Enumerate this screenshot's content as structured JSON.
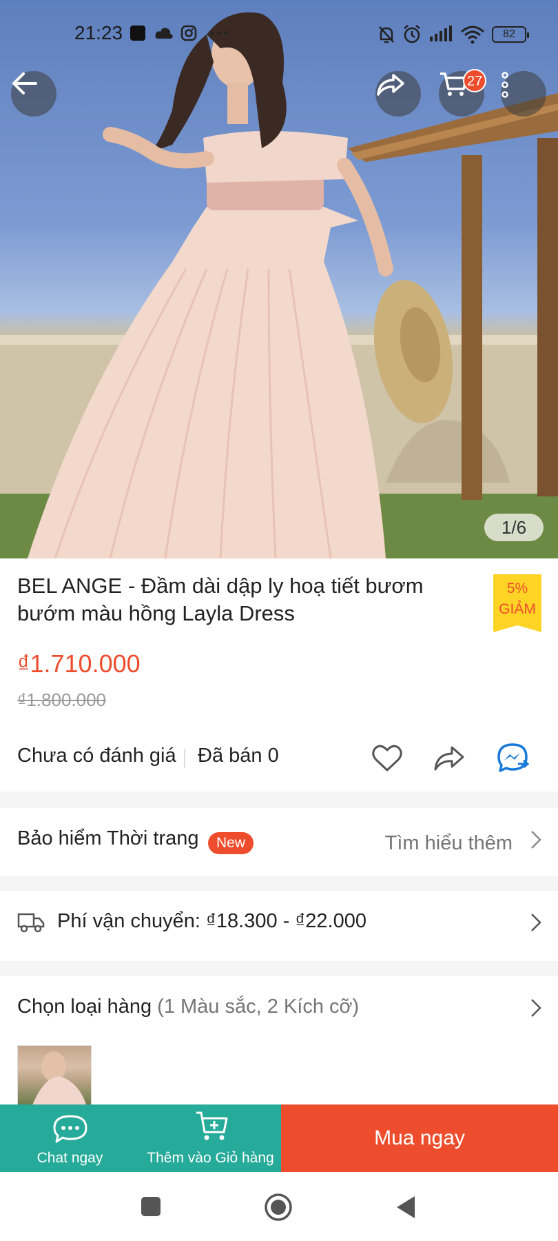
{
  "status_bar": {
    "time": "21:23",
    "battery": "82",
    "icons": [
      "notification-square-icon",
      "cloud-icon",
      "instagram-icon",
      "more-dots-icon",
      "mute-bell-icon",
      "alarm-icon",
      "signal-icon",
      "wifi-icon",
      "battery-icon"
    ]
  },
  "header": {
    "back_icon": "arrow-left-icon",
    "share_icon": "share-icon",
    "cart_icon": "cart-icon",
    "cart_count": "27",
    "menu_icon": "more-vertical-icon"
  },
  "gallery": {
    "counter": "1/6"
  },
  "product": {
    "title": "BEL ANGE - Đầm dài dập ly hoạ tiết bươm bướm màu hồng Layla Dress",
    "discount_percent": "5%",
    "discount_label": "GIẢM",
    "price": "₫1.710.000",
    "original_price": "₫1.800.000",
    "rating_text": "Chưa có đánh giá",
    "sold_text": "Đã bán 0"
  },
  "insurance": {
    "label": "Bảo hiểm Thời trang",
    "badge": "New",
    "link": "Tìm hiểu thêm"
  },
  "shipping": {
    "label": "Phí vận chuyển: ₫18.300 - ₫22.000"
  },
  "variants": {
    "label": "Chọn loại hàng",
    "detail": "(1 Màu sắc, 2 Kích cỡ)"
  },
  "bottom_bar": {
    "chat_label": "Chat ngay",
    "add_cart_label": "Thêm vào Giỏ hàng",
    "buy_label": "Mua ngay"
  },
  "colors": {
    "accent": "#ee4d2d",
    "teal": "#26aa99",
    "tag_yellow": "#ffd424"
  }
}
